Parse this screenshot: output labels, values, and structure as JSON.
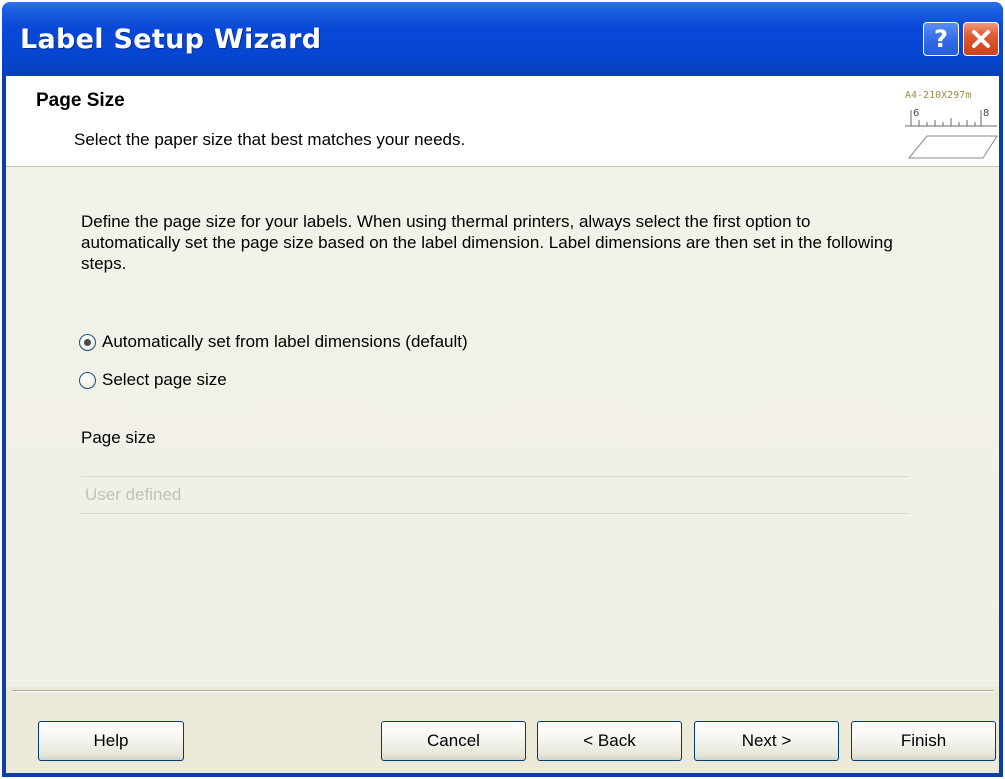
{
  "window": {
    "title": "Label Setup Wizard",
    "help_glyph": "?",
    "close_glyph": "✕"
  },
  "header": {
    "title": "Page Size",
    "subtitle": "Select the paper size that best matches your needs.",
    "icon": "page-size-ruler-icon",
    "icon_caption": "A4-210X297m",
    "icon_tick_left": "6",
    "icon_tick_right": "8"
  },
  "body": {
    "description": "Define the page size for your labels. When using thermal printers, always select the first option to automatically set the page size based on the label dimension. Label dimensions are then set in the following steps.",
    "options": [
      {
        "label": "Automatically set from label dimensions (default)",
        "checked": true
      },
      {
        "label": "Select page size",
        "checked": false
      }
    ],
    "page_size_label": "Page size",
    "page_size_value": "User defined",
    "page_size_enabled": false
  },
  "footer": {
    "help_label": "Help",
    "cancel_label": "Cancel",
    "back_label": "< Back",
    "next_label": "Next >",
    "finish_label": "Finish"
  },
  "colors": {
    "titlebar": "#0646d1",
    "close_button": "#e05a32",
    "dialog_background": "#ece9d8",
    "button_border": "#003c74"
  }
}
